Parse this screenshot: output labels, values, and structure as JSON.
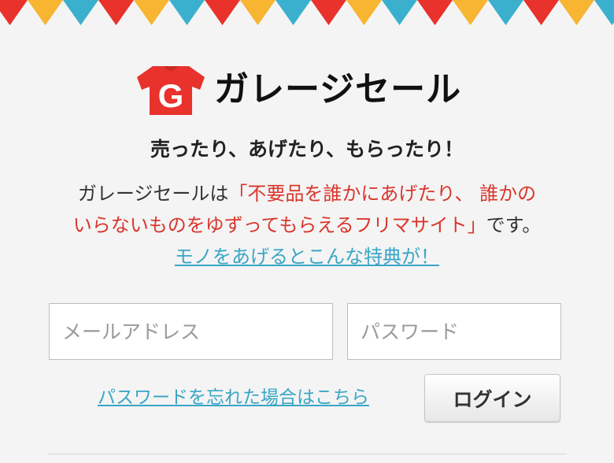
{
  "brand": {
    "name": "ガレージセール",
    "icon_letter": "G"
  },
  "tagline": "売ったり、あげたり、もらったり！",
  "description": {
    "prefix": "ガレージセールは",
    "quote_line1": "「不要品を誰かにあげたり、 誰かの",
    "quote_line2": "いらないものをゆずってもらえるフリマサイト」",
    "suffix": "です。"
  },
  "feature_link": "モノをあげるとこんな特典が！",
  "form": {
    "email_placeholder": "メールアドレス",
    "password_placeholder": "パスワード",
    "forgot_link": "パスワードを忘れた場合はこちら",
    "login_button": "ログイン"
  },
  "colors": {
    "pennant_red": "#e8322b",
    "pennant_yellow": "#f7b531",
    "pennant_blue": "#3bb0ce",
    "logo_red": "#e8322b",
    "link_blue": "#3aa6c6",
    "highlight_red": "#d9362c"
  },
  "icons": {
    "pennant_banner": "bunting-decoration",
    "logo": "t-shirt-g-logo"
  }
}
